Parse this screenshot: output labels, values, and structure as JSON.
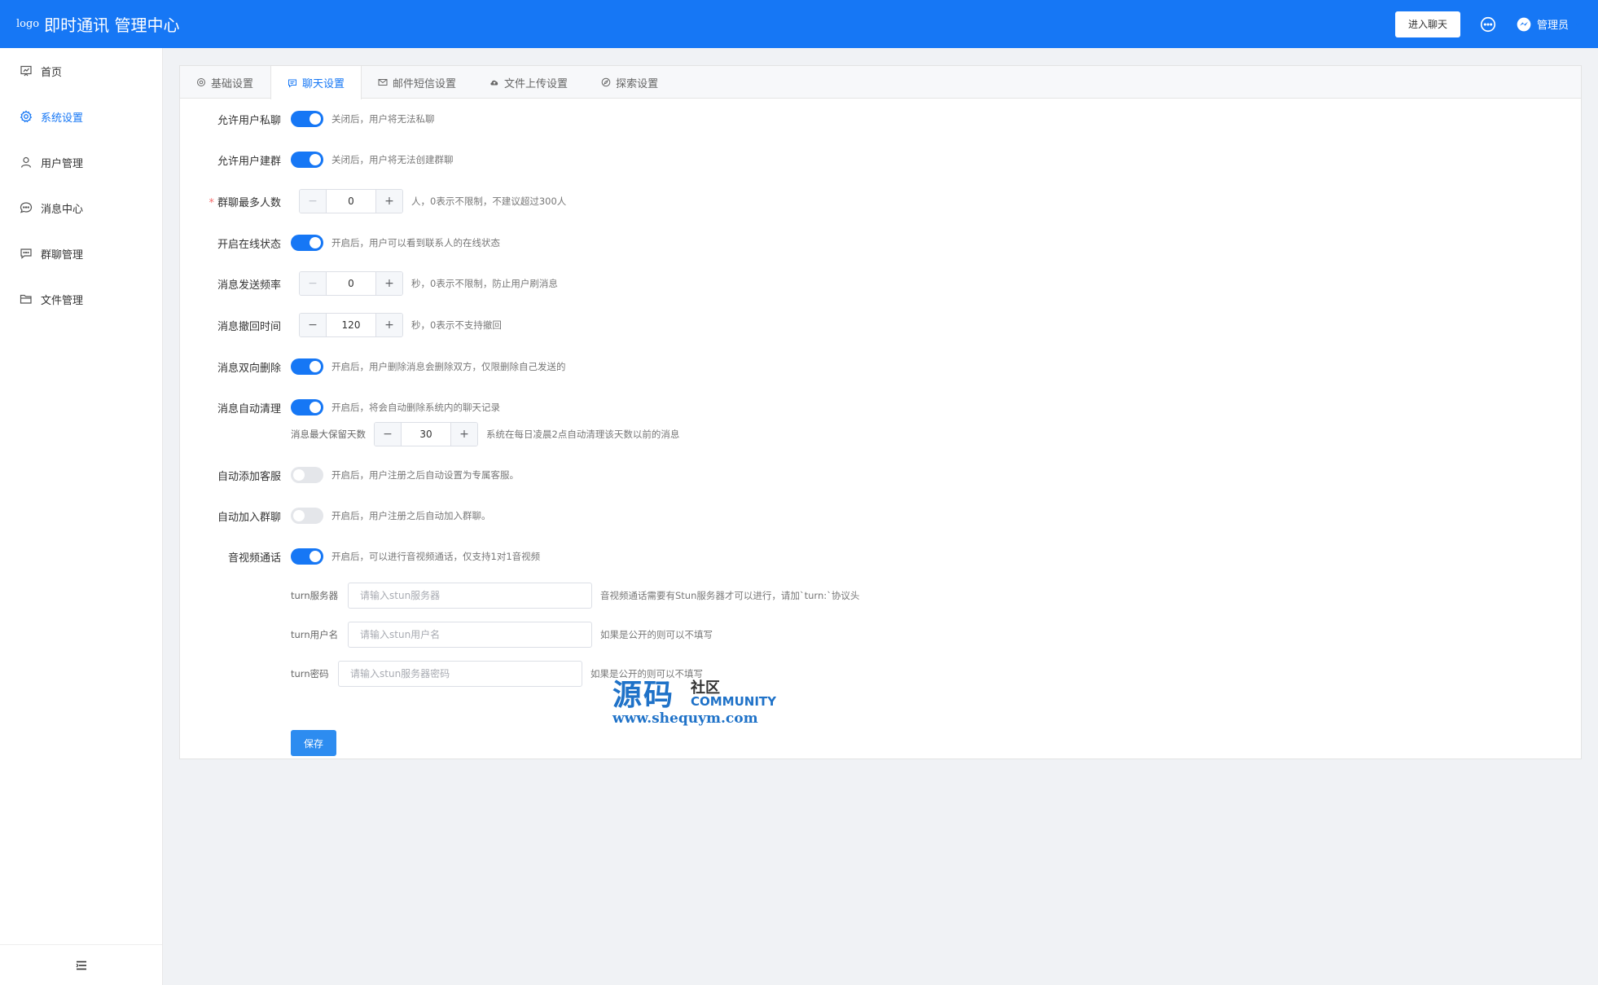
{
  "header": {
    "logo_alt": "logo",
    "title": "即时通讯 管理中心",
    "enter_chat": "进入聊天",
    "admin_label": "管理员"
  },
  "sidebar": {
    "items": [
      {
        "label": "首页",
        "icon": "home-chart-icon"
      },
      {
        "label": "系统设置",
        "icon": "gear-icon",
        "active": true
      },
      {
        "label": "用户管理",
        "icon": "user-icon"
      },
      {
        "label": "消息中心",
        "icon": "chat-bubble-icon"
      },
      {
        "label": "群聊管理",
        "icon": "group-chat-icon"
      },
      {
        "label": "文件管理",
        "icon": "folder-icon"
      }
    ]
  },
  "tabs": [
    {
      "label": "基础设置",
      "icon": "gear-icon"
    },
    {
      "label": "聊天设置",
      "icon": "chat-icon",
      "active": true
    },
    {
      "label": "邮件短信设置",
      "icon": "mail-icon"
    },
    {
      "label": "文件上传设置",
      "icon": "cloud-upload-icon"
    },
    {
      "label": "探索设置",
      "icon": "compass-icon"
    }
  ],
  "form": {
    "private_chat": {
      "label": "允许用户私聊",
      "on": true,
      "help": "关闭后，用户将无法私聊"
    },
    "create_group": {
      "label": "允许用户建群",
      "on": true,
      "help": "关闭后，用户将无法创建群聊"
    },
    "max_group": {
      "label": "群聊最多人数",
      "required": "*",
      "value": "0",
      "help": "人，0表示不限制，不建议超过300人"
    },
    "online_status": {
      "label": "开启在线状态",
      "on": true,
      "help": "开启后，用户可以看到联系人的在线状态"
    },
    "send_rate": {
      "label": "消息发送频率",
      "value": "0",
      "help": "秒，0表示不限制，防止用户刷消息"
    },
    "recall_time": {
      "label": "消息撤回时间",
      "value": "120",
      "help": "秒，0表示不支持撤回"
    },
    "two_way_delete": {
      "label": "消息双向删除",
      "on": true,
      "help": "开启后，用户删除消息会删除双方，仅限删除自己发送的"
    },
    "auto_clean": {
      "label": "消息自动清理",
      "on": true,
      "help": "开启后，将会自动删除系统内的聊天记录",
      "keep_days_label": "消息最大保留天数",
      "keep_days": "30",
      "keep_days_help": "系统在每日凌晨2点自动清理该天数以前的消息"
    },
    "auto_service": {
      "label": "自动添加客服",
      "on": false,
      "help": "开启后，用户注册之后自动设置为专属客服。"
    },
    "auto_join_group": {
      "label": "自动加入群聊",
      "on": false,
      "help": "开启后，用户注册之后自动加入群聊。"
    },
    "av_call": {
      "label": "音视频通话",
      "on": true,
      "help": "开启后，可以进行音视频通话，仅支持1对1音视频"
    },
    "turn_server": {
      "label": "turn服务器",
      "placeholder": "请输入stun服务器",
      "help": "音视频通话需要有Stun服务器才可以进行，请加`turn:`协议头"
    },
    "turn_user": {
      "label": "turn用户名",
      "placeholder": "请输入stun用户名",
      "help": "如果是公开的则可以不填写"
    },
    "turn_pass": {
      "label": "turn密码",
      "placeholder": "请输入stun服务器密码",
      "help": "如果是公开的则可以不填写"
    },
    "save": "保存"
  },
  "watermark": {
    "big": "源码",
    "she": "社区",
    "community": "COMMUNITY",
    "url": "www.shequym.com"
  }
}
